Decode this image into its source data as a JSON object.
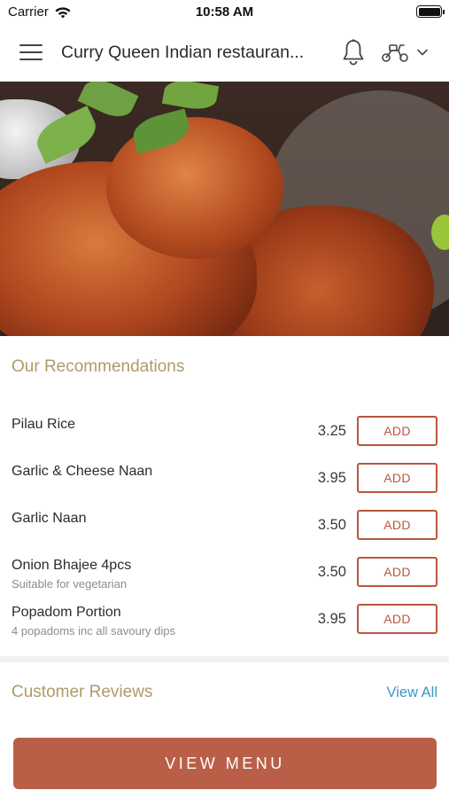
{
  "status_bar": {
    "carrier": "Carrier",
    "time": "10:58 AM",
    "battery_percent": 100
  },
  "header": {
    "title": "Curry Queen Indian restauran...",
    "icons": [
      "menu-icon",
      "bell-icon",
      "scooter-icon",
      "chevron-down-icon"
    ]
  },
  "hero": {
    "image": "tandoori-chicken-photo"
  },
  "recommendations": {
    "title": "Our Recommendations",
    "items": [
      {
        "name": "Pilau Rice",
        "desc": "",
        "price": "3.25",
        "button": "ADD"
      },
      {
        "name": "Garlic & Cheese Naan",
        "desc": "",
        "price": "3.95",
        "button": "ADD"
      },
      {
        "name": "Garlic Naan",
        "desc": "",
        "price": "3.50",
        "button": "ADD"
      },
      {
        "name": "Onion Bhajee 4pcs",
        "desc": "Suitable for vegetarian",
        "price": "3.50",
        "button": "ADD"
      },
      {
        "name": "Popadom Portion",
        "desc": "4 popadoms inc all savoury dips",
        "price": "3.95",
        "button": "ADD"
      }
    ]
  },
  "reviews": {
    "title": "Customer Reviews",
    "view_all": "View All"
  },
  "footer": {
    "view_menu": "VIEW MENU"
  },
  "colors": {
    "accent": "#b95f48",
    "section_title": "#b09a6a",
    "link": "#3a98c8"
  }
}
